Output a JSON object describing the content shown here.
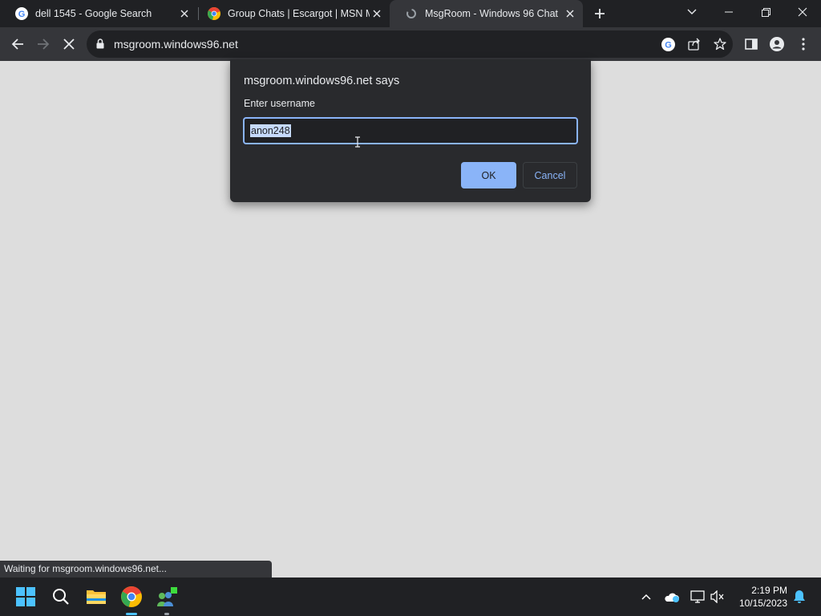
{
  "tabs": [
    {
      "title": "dell 1545 - Google Search",
      "icon": "google-icon",
      "active": false
    },
    {
      "title": "Group Chats | Escargot | MSN M",
      "icon": "chrome-icon",
      "active": false
    },
    {
      "title": "MsgRoom - Windows 96 Chat",
      "icon": "msgroom-icon",
      "active": true
    }
  ],
  "address_bar": {
    "url": "msgroom.windows96.net"
  },
  "dialog": {
    "title": "msgroom.windows96.net says",
    "message": "Enter username",
    "input_value": "anon248",
    "ok_label": "OK",
    "cancel_label": "Cancel"
  },
  "status_bar": {
    "text": "Waiting for msgroom.windows96.net..."
  },
  "taskbar": {
    "time": "2:19 PM",
    "date": "10/15/2023"
  },
  "colors": {
    "accent": "#8ab4f8",
    "page_bg": "#dddddd",
    "chrome_dark": "#202124",
    "toolbar": "#35363a"
  }
}
